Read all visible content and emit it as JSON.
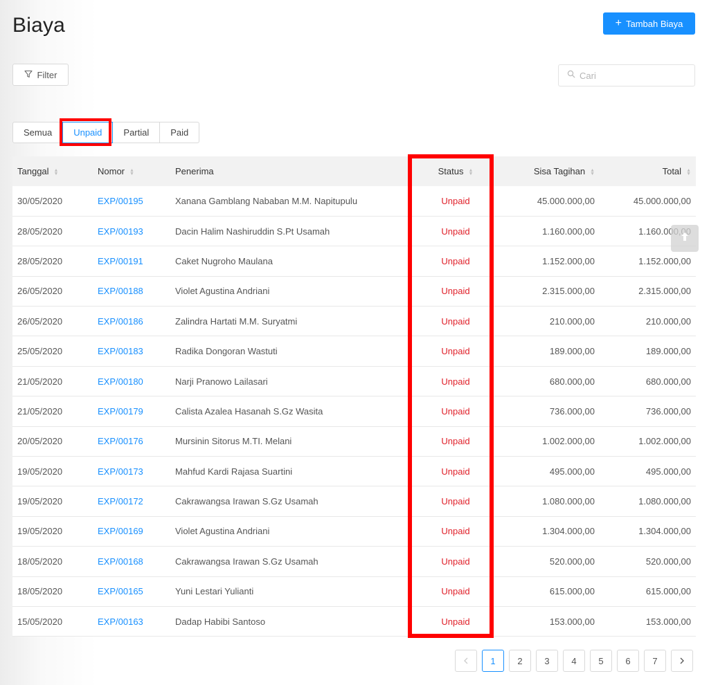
{
  "page": {
    "title": "Biaya"
  },
  "toolbar": {
    "add_label": "Tambah Biaya",
    "filter_label": "Filter",
    "search_placeholder": "Cari"
  },
  "tabs": [
    {
      "label": "Semua"
    },
    {
      "label": "Unpaid",
      "active": true
    },
    {
      "label": "Partial"
    },
    {
      "label": "Paid"
    }
  ],
  "table": {
    "headers": {
      "tanggal": "Tanggal",
      "nomor": "Nomor",
      "penerima": "Penerima",
      "status": "Status",
      "sisa": "Sisa Tagihan",
      "total": "Total"
    },
    "rows": [
      {
        "tanggal": "30/05/2020",
        "nomor": "EXP/00195",
        "penerima": "Xanana Gamblang Nababan M.M. Napitupulu",
        "status": "Unpaid",
        "sisa": "45.000.000,00",
        "total": "45.000.000,00"
      },
      {
        "tanggal": "28/05/2020",
        "nomor": "EXP/00193",
        "penerima": "Dacin Halim Nashiruddin S.Pt Usamah",
        "status": "Unpaid",
        "sisa": "1.160.000,00",
        "total": "1.160.000,00"
      },
      {
        "tanggal": "28/05/2020",
        "nomor": "EXP/00191",
        "penerima": "Caket Nugroho Maulana",
        "status": "Unpaid",
        "sisa": "1.152.000,00",
        "total": "1.152.000,00"
      },
      {
        "tanggal": "26/05/2020",
        "nomor": "EXP/00188",
        "penerima": "Violet Agustina Andriani",
        "status": "Unpaid",
        "sisa": "2.315.000,00",
        "total": "2.315.000,00"
      },
      {
        "tanggal": "26/05/2020",
        "nomor": "EXP/00186",
        "penerima": "Zalindra Hartati M.M. Suryatmi",
        "status": "Unpaid",
        "sisa": "210.000,00",
        "total": "210.000,00"
      },
      {
        "tanggal": "25/05/2020",
        "nomor": "EXP/00183",
        "penerima": "Radika Dongoran Wastuti",
        "status": "Unpaid",
        "sisa": "189.000,00",
        "total": "189.000,00"
      },
      {
        "tanggal": "21/05/2020",
        "nomor": "EXP/00180",
        "penerima": "Narji Pranowo Lailasari",
        "status": "Unpaid",
        "sisa": "680.000,00",
        "total": "680.000,00"
      },
      {
        "tanggal": "21/05/2020",
        "nomor": "EXP/00179",
        "penerima": "Calista Azalea Hasanah S.Gz Wasita",
        "status": "Unpaid",
        "sisa": "736.000,00",
        "total": "736.000,00"
      },
      {
        "tanggal": "20/05/2020",
        "nomor": "EXP/00176",
        "penerima": "Mursinin Sitorus M.TI. Melani",
        "status": "Unpaid",
        "sisa": "1.002.000,00",
        "total": "1.002.000,00"
      },
      {
        "tanggal": "19/05/2020",
        "nomor": "EXP/00173",
        "penerima": "Mahfud Kardi Rajasa Suartini",
        "status": "Unpaid",
        "sisa": "495.000,00",
        "total": "495.000,00"
      },
      {
        "tanggal": "19/05/2020",
        "nomor": "EXP/00172",
        "penerima": "Cakrawangsa Irawan S.Gz Usamah",
        "status": "Unpaid",
        "sisa": "1.080.000,00",
        "total": "1.080.000,00"
      },
      {
        "tanggal": "19/05/2020",
        "nomor": "EXP/00169",
        "penerima": "Violet Agustina Andriani",
        "status": "Unpaid",
        "sisa": "1.304.000,00",
        "total": "1.304.000,00"
      },
      {
        "tanggal": "18/05/2020",
        "nomor": "EXP/00168",
        "penerima": "Cakrawangsa Irawan S.Gz Usamah",
        "status": "Unpaid",
        "sisa": "520.000,00",
        "total": "520.000,00"
      },
      {
        "tanggal": "18/05/2020",
        "nomor": "EXP/00165",
        "penerima": "Yuni Lestari Yulianti",
        "status": "Unpaid",
        "sisa": "615.000,00",
        "total": "615.000,00"
      },
      {
        "tanggal": "15/05/2020",
        "nomor": "EXP/00163",
        "penerima": "Dadap Habibi Santoso",
        "status": "Unpaid",
        "sisa": "153.000,00",
        "total": "153.000,00"
      }
    ]
  },
  "pagination": {
    "prev_icon": "chevron-left-icon",
    "next_icon": "chevron-right-icon",
    "pages": [
      "1",
      "2",
      "3",
      "4",
      "5",
      "6",
      "7"
    ],
    "current": "1"
  },
  "icons": {
    "filter": "filter-icon",
    "search": "search-icon",
    "add": "plus-icon",
    "scroll_top": "arrow-up-icon",
    "sort": "sort-icon"
  },
  "colors": {
    "primary": "#1890ff",
    "status_unpaid": "#e0202a",
    "highlight": "#ff0000"
  }
}
